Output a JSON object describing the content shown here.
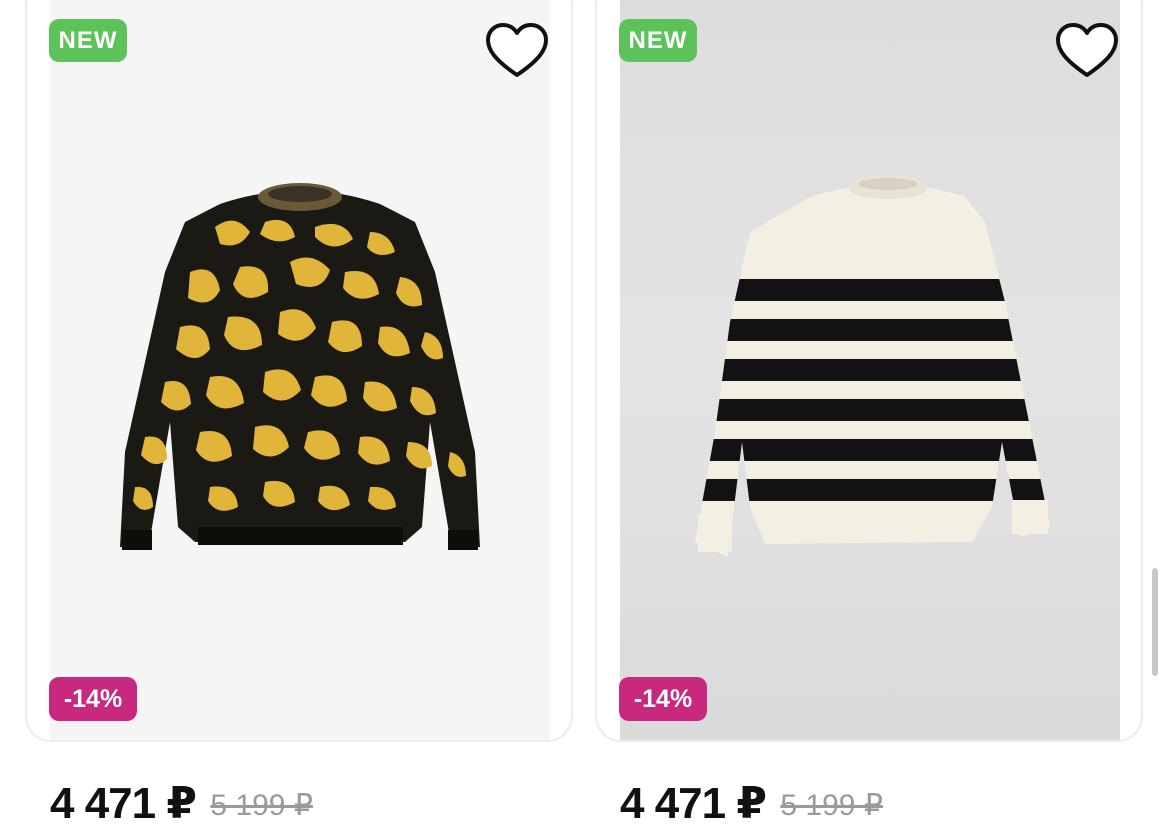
{
  "products": [
    {
      "badge_new": "NEW",
      "badge_discount": "-14%",
      "price_current": "4 471 ₽",
      "price_old": "5 199 ₽",
      "image": "leopard-print-sweater"
    },
    {
      "badge_new": "NEW",
      "badge_discount": "-14%",
      "price_current": "4 471 ₽",
      "price_old": "5 199 ₽",
      "image": "striped-sweater"
    }
  ],
  "colors": {
    "new_badge": "#5ec25a",
    "discount_badge": "#c8297e",
    "price_text": "#111111",
    "old_price_text": "#9a9a9a"
  },
  "icons": {
    "favorite": "heart-outline-icon"
  }
}
